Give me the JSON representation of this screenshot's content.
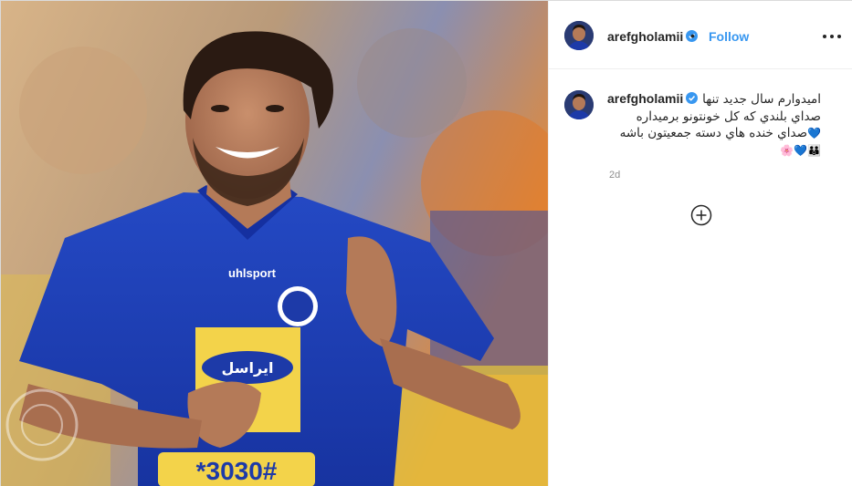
{
  "post": {
    "username": "arefgholamii",
    "follow_label": "Follow",
    "separator": "•",
    "more_icon": "more-horizontal-icon",
    "verified_icon": "verified-badge-icon",
    "caption_lines": [
      "اميدوارم سال جديد تنها",
      "صداي بلندي كه كل خونتونو برميداره",
      "صداي خنده هاي دسته جمعيتون باشه"
    ],
    "caption_emoji_line1_end": "💙",
    "caption_emoji_line2": "👪💙🌸",
    "timestamp": "2d",
    "add_icon": "plus-circle-icon",
    "colors": {
      "link_blue": "#3897f0",
      "text": "#262626",
      "muted": "#8e8e8e",
      "jersey_blue": "#1e3fb0"
    },
    "photo": {
      "description_icon": "football-player-photo",
      "jersey_text_1": "uhlsport",
      "jersey_text_2": "ايراسل",
      "jersey_text_3": "*3030#"
    }
  }
}
